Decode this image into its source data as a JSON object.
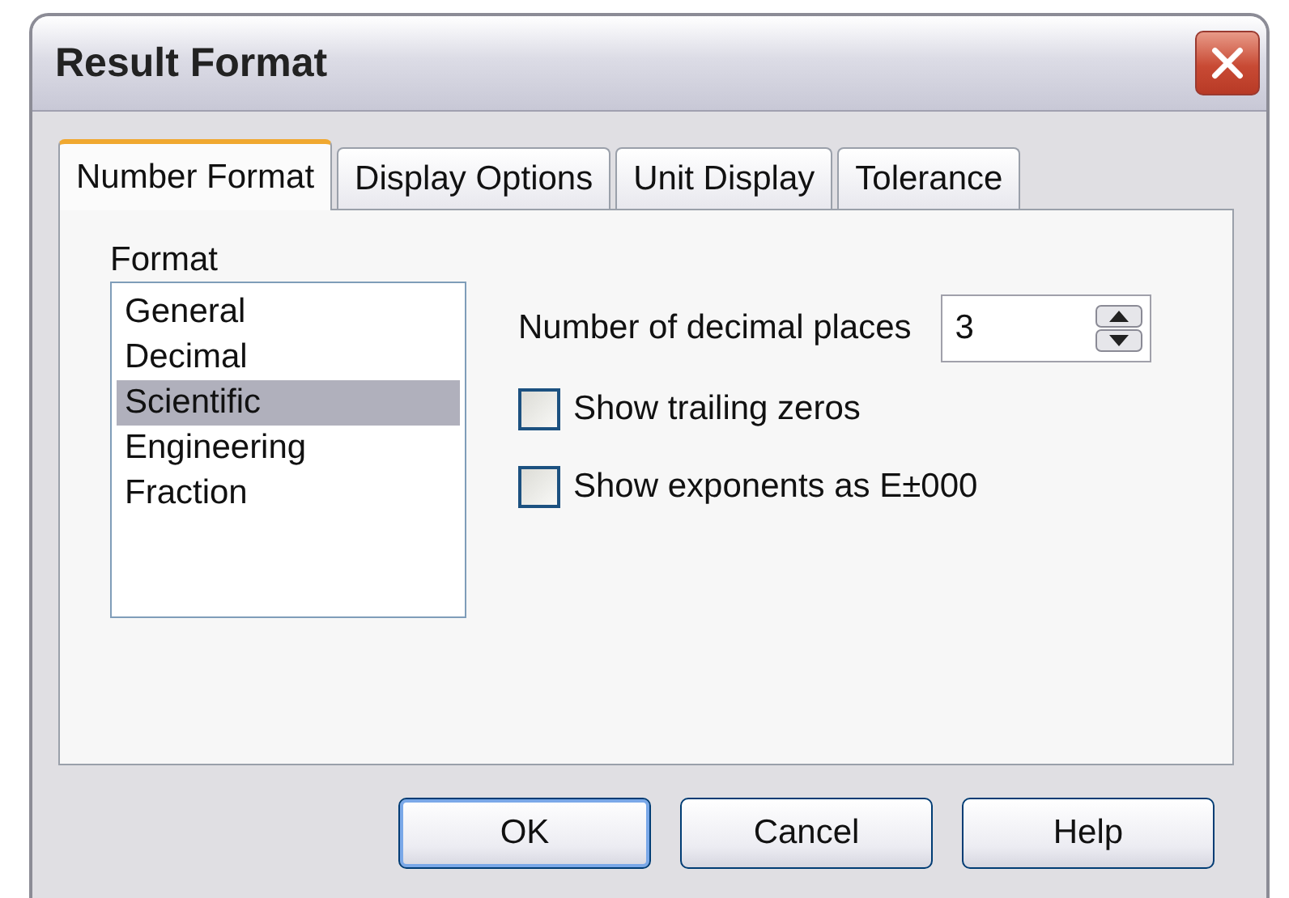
{
  "window": {
    "title": "Result Format"
  },
  "tabs": [
    {
      "label": "Number Format",
      "selected": true
    },
    {
      "label": "Display Options",
      "selected": false
    },
    {
      "label": "Unit Display",
      "selected": false
    },
    {
      "label": "Tolerance",
      "selected": false
    }
  ],
  "format": {
    "label": "Format",
    "items": [
      {
        "label": "General",
        "selected": false
      },
      {
        "label": "Decimal",
        "selected": false
      },
      {
        "label": "Scientific",
        "selected": true
      },
      {
        "label": "Engineering",
        "selected": false
      },
      {
        "label": "Fraction",
        "selected": false
      }
    ]
  },
  "decimal_places": {
    "label": "Number of decimal places",
    "value": "3"
  },
  "options": [
    {
      "label": "Show trailing zeros",
      "checked": false
    },
    {
      "label": "Show exponents as E±000",
      "checked": false
    }
  ],
  "buttons": [
    {
      "label": "OK",
      "selected": true
    },
    {
      "label": "Cancel",
      "selected": false
    },
    {
      "label": "Help",
      "selected": false
    }
  ]
}
